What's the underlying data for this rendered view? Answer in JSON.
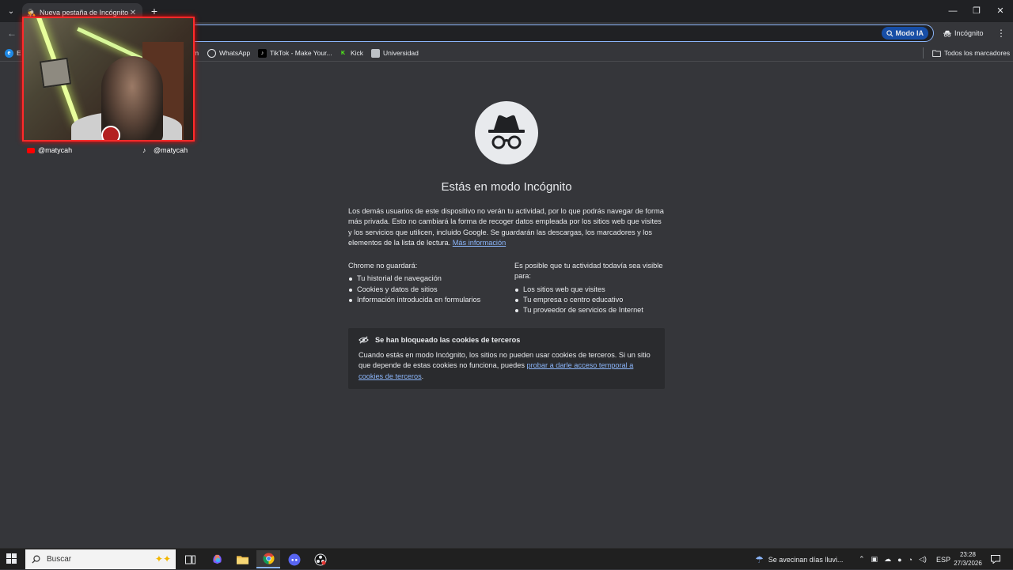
{
  "tabs": [
    {
      "title": "Nueva pestaña de Incógnito",
      "close": "✕"
    }
  ],
  "new_tab": "+",
  "window_controls": {
    "minimize": "—",
    "maximize": "❐",
    "close": "✕"
  },
  "toolbar": {
    "mode_ia_label": "Modo IA",
    "incognito_label": "Incógnito",
    "menu": "⋮"
  },
  "bookmarks": [
    {
      "label": "E",
      "icon": "edge-icon"
    },
    {
      "label": "m",
      "icon": "gmail-icon"
    },
    {
      "label": "WhatsApp",
      "icon": "whatsapp-icon"
    },
    {
      "label": "TikTok - Make Your...",
      "icon": "tiktok-icon"
    },
    {
      "label": "Kick",
      "icon": "kick-icon"
    },
    {
      "label": "Universidad",
      "icon": "page-icon"
    }
  ],
  "all_bookmarks_label": "Todos los marcadores",
  "webcam": {
    "youtube_handle": "@matycah",
    "tiktok_handle": "@matycah"
  },
  "main": {
    "title": "Estás en modo Incógnito",
    "intro": "Los demás usuarios de este dispositivo no verán tu actividad, por lo que podrás navegar de forma más privada. Esto no cambiará la forma de recoger datos empleada por los sitios web que visites y los servicios que utilicen, incluido Google. Se guardarán las descargas, los marcadores y los elementos de la lista de lectura.",
    "more_info_link": "Más información",
    "left_heading": "Chrome no guardará:",
    "left_items": [
      "Tu historial de navegación",
      "Cookies y datos de sitios",
      "Información introducida en formularios"
    ],
    "right_heading": "Es posible que tu actividad todavía sea visible para:",
    "right_items": [
      "Los sitios web que visites",
      "Tu empresa o centro educativo",
      "Tu proveedor de servicios de Internet"
    ],
    "cookie_title": "Se han bloqueado las cookies de terceros",
    "cookie_text": "Cuando estás en modo Incógnito, los sitios no pueden usar cookies de terceros. Si un sitio que depende de estas cookies no funciona, puedes",
    "cookie_link": "probar a darle acceso temporal a cookies de terceros"
  },
  "taskbar": {
    "search_placeholder": "Buscar",
    "weather_text": "Se avecinan días lluvi...",
    "lang": "ESP",
    "time": "23:28",
    "date": "27/3/2026"
  },
  "colors": {
    "accent": "#8ab4f8",
    "webcam_border": "#ff2a2a",
    "background": "#35363a"
  }
}
